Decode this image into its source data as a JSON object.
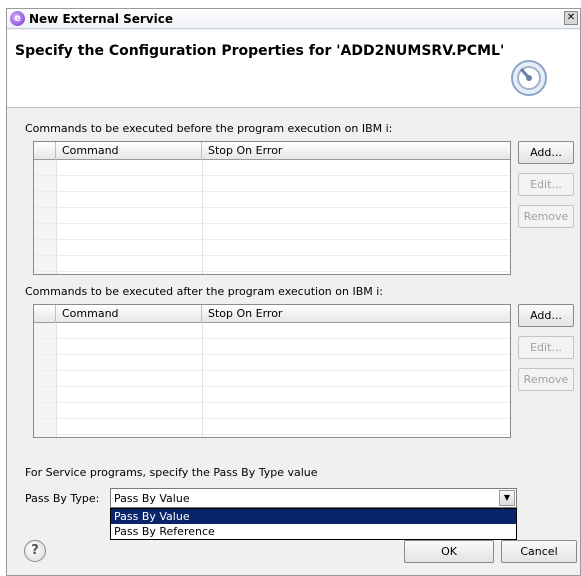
{
  "window": {
    "title": "New External Service",
    "close_glyph": "✕"
  },
  "header": {
    "title": "Specify the Configuration Properties for 'ADD2NUMSRV.PCML'",
    "icon": "wizard-gear-icon"
  },
  "before_section": {
    "label": "Commands to be executed before the program execution on IBM i:",
    "columns": [
      "Command",
      "Stop On Error"
    ],
    "buttons": {
      "add": "Add...",
      "edit": "Edit...",
      "remove": "Remove"
    }
  },
  "after_section": {
    "label": "Commands to be executed after the program execution on IBM i:",
    "columns": [
      "Command",
      "Stop On Error"
    ],
    "buttons": {
      "add": "Add...",
      "edit": "Edit...",
      "remove": "Remove"
    }
  },
  "pass_by": {
    "instruction": "For Service programs, specify the Pass By Type value",
    "label": "Pass By Type:",
    "selected": "Pass By Value",
    "options": [
      "Pass By Value",
      "Pass By Reference"
    ]
  },
  "footer": {
    "help_glyph": "?",
    "ok": "OK",
    "cancel": "Cancel"
  }
}
